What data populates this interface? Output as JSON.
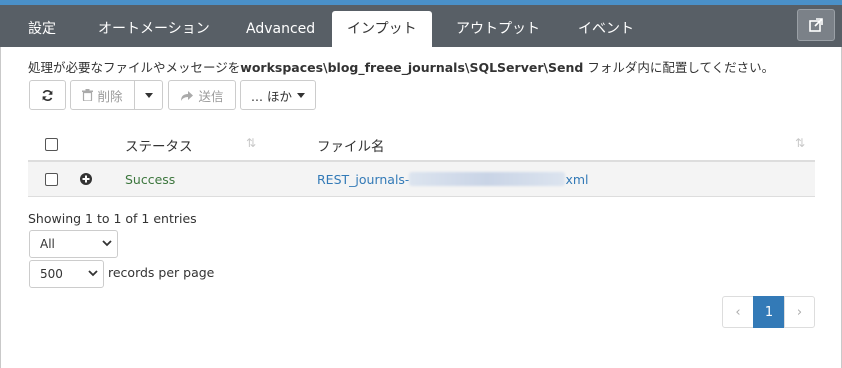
{
  "tabs": [
    {
      "label": "設定"
    },
    {
      "label": "オートメーション"
    },
    {
      "label": "Advanced"
    },
    {
      "label": "インプット",
      "active": true
    },
    {
      "label": "アウトプット"
    },
    {
      "label": "イベント"
    }
  ],
  "description": {
    "prefix": "処理が必要なファイルやメッセージを",
    "path": "workspaces\\blog_freee_journals\\SQLServer\\Send",
    "suffix": " フォルダ内に配置してください。"
  },
  "toolbar": {
    "delete_label": "削除",
    "send_label": "送信",
    "more_label": "... ほか"
  },
  "table": {
    "headers": {
      "status": "ステータス",
      "filename": "ファイル名"
    },
    "rows": [
      {
        "status": "Success",
        "filename_prefix": "REST_journals-",
        "filename_suffix": "xml"
      }
    ]
  },
  "info": "Showing 1 to 1 of 1 entries",
  "filter_select": {
    "value": "All"
  },
  "page_length_select": {
    "value": "500"
  },
  "records_per_page": "records per page",
  "pagination": {
    "prev": "‹",
    "current": "1",
    "next": "›"
  },
  "colors": {
    "accent": "#337ab7",
    "success": "#3c763d",
    "tabbar": "#585f66"
  }
}
